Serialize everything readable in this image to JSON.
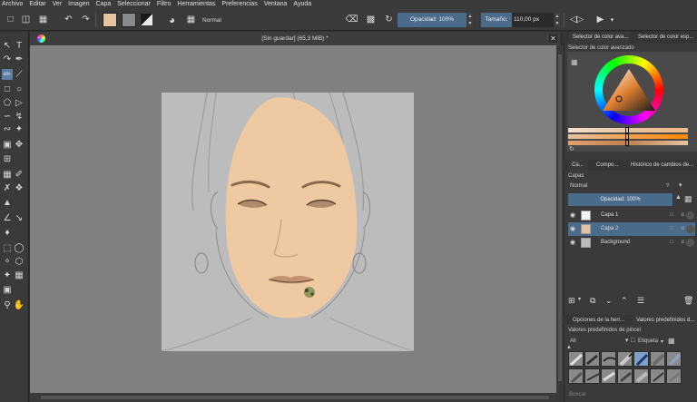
{
  "menu": [
    "Archivo",
    "Editar",
    "Ver",
    "Imagen",
    "Capa",
    "Seleccionar",
    "Filtro",
    "Herramientas",
    "Preferencias",
    "Ventana",
    "Ayuda"
  ],
  "toolbar": {
    "blend_mode": "Normal",
    "opacity_label": "Opacidad: 100%",
    "size_label": "Tamaño:",
    "size_value": "110,00 px"
  },
  "colors": {
    "foreground": "#e6c3a0",
    "background": "#8a8a8a",
    "accent": "#4a6b8a",
    "skin": "#efc9a2",
    "canvas_bg": "#bcbcbc"
  },
  "document": {
    "title": "[Sin guardar]  (65,3 MiB) *"
  },
  "dock": {
    "tab1": "Selector de color ava...",
    "tab2": "Selector de color esp...",
    "color_panel_title": "Selector de color avanzado",
    "layers_tabs": [
      "Ca...",
      "Compo...",
      "Histórico de cambios de..."
    ],
    "layers_title": "Capas",
    "layer_blend": "Normal",
    "layer_opacity": "Opacidad:  100%",
    "layers": [
      {
        "name": "Capa 1",
        "selected": false
      },
      {
        "name": "Capa 2",
        "selected": true
      },
      {
        "name": "Background",
        "selected": false
      }
    ],
    "brush_tabs": [
      "Opciones de la herr...",
      "Valores predefinidos d..."
    ],
    "brush_title": "Valores predefinidos de pincel",
    "brush_filter": "All",
    "brush_tag": "Etiqueta",
    "search_placeholder": "Buscar"
  }
}
